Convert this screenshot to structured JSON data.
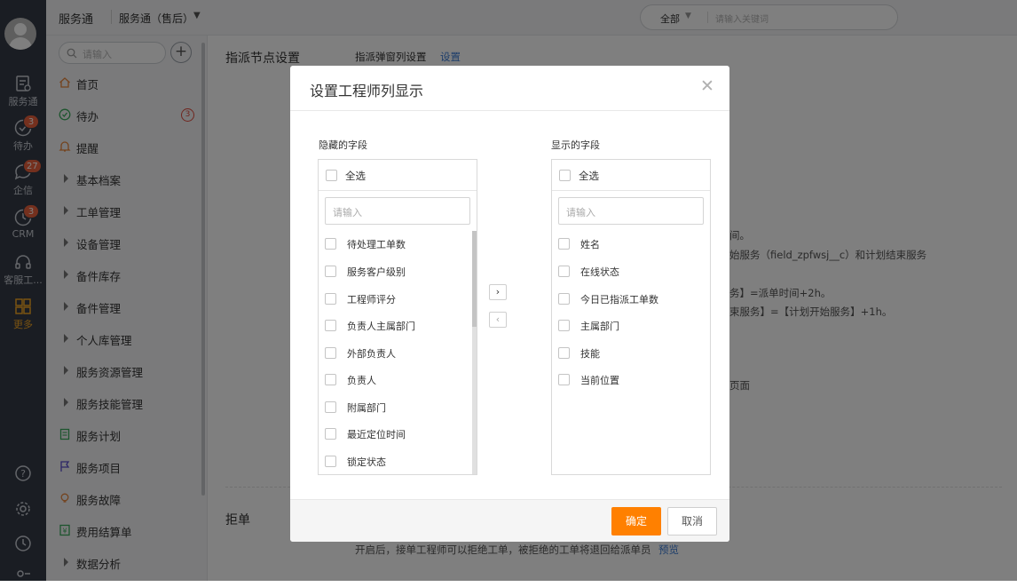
{
  "rail": {
    "items": [
      {
        "label": "服务通",
        "icon": "service-icon"
      },
      {
        "label": "待办",
        "icon": "todo-icon",
        "badge": "3"
      },
      {
        "label": "企信",
        "icon": "message-icon",
        "badge": "27"
      },
      {
        "label": "CRM",
        "icon": "crm-icon",
        "badge": "3"
      },
      {
        "label": "客服工...",
        "icon": "headset-icon"
      },
      {
        "label": "更多",
        "icon": "grid-icon",
        "active": true
      }
    ],
    "bottom_icons": [
      "help-icon",
      "settings-icon",
      "clock-icon",
      "profile-icon"
    ]
  },
  "topbar": {
    "app_name": "服务通",
    "app_sub": "服务通（售后）",
    "search_scope": "全部",
    "search_placeholder": "请输入关键词"
  },
  "sidebar": {
    "search_placeholder": "请输入",
    "items": [
      {
        "label": "首页",
        "icon": "home-icon"
      },
      {
        "label": "待办",
        "icon": "check-circle-icon",
        "badge": "3"
      },
      {
        "label": "提醒",
        "icon": "bell-icon"
      },
      {
        "label": "基本档案",
        "icon": "caret-right-icon"
      },
      {
        "label": "工单管理",
        "icon": "caret-right-icon"
      },
      {
        "label": "设备管理",
        "icon": "caret-right-icon"
      },
      {
        "label": "备件库存",
        "icon": "caret-right-icon"
      },
      {
        "label": "备件管理",
        "icon": "caret-right-icon"
      },
      {
        "label": "个人库管理",
        "icon": "caret-right-icon"
      },
      {
        "label": "服务资源管理",
        "icon": "caret-right-icon"
      },
      {
        "label": "服务技能管理",
        "icon": "caret-right-icon"
      },
      {
        "label": "服务计划",
        "icon": "document-icon"
      },
      {
        "label": "服务项目",
        "icon": "flag-icon"
      },
      {
        "label": "服务故障",
        "icon": "bulb-icon"
      },
      {
        "label": "费用结算单",
        "icon": "yen-icon"
      },
      {
        "label": "数据分析",
        "icon": "caret-right-icon"
      }
    ]
  },
  "main": {
    "section1_title": "指派节点设置",
    "dispatch_popup_label": "指派弹窗列设置",
    "dispatch_popup_link": "设置",
    "bg_lines": [
      "间。",
      "始服务（field_zpfwsj__c）和计划结束服务",
      "务】=派单时间+2h。",
      "束服务】=【计划开始服务】+1h。",
      "页面"
    ],
    "section2_title": "拒单",
    "reject_desc": "开启后，接单工程师可以拒绝工单，被拒绝的工单将退回给派单员",
    "reject_link": "预览"
  },
  "modal": {
    "title": "设置工程师列显示",
    "hidden_label": "隐藏的字段",
    "shown_label": "显示的字段",
    "select_all": "全选",
    "search_placeholder": "请输入",
    "hidden_fields": [
      "待处理工单数",
      "服务客户级别",
      "工程师评分",
      "负责人主属部门",
      "外部负责人",
      "负责人",
      "附属部门",
      "最近定位时间",
      "锁定状态"
    ],
    "shown_fields": [
      "姓名",
      "在线状态",
      "今日已指派工单数",
      "主属部门",
      "技能",
      "当前位置"
    ],
    "move_right": "›",
    "move_left": "‹",
    "confirm": "确定",
    "cancel": "取消"
  },
  "colors": {
    "accent": "#ff8000",
    "link": "#3a7bd5",
    "rail_bg": "#343a46",
    "badge": "#e8613c"
  }
}
